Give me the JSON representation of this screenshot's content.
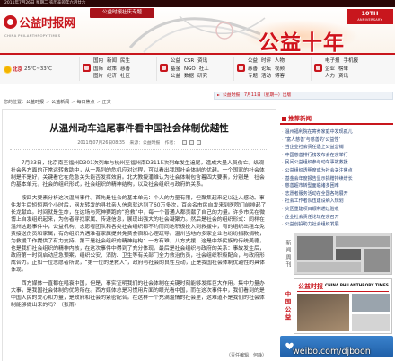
{
  "topbar": {
    "date": "2011年7月26日 星期二 农历辛卯年六月廿六"
  },
  "header": {
    "logo_cn": "公益时报网",
    "logo_en": "CHINA PHILANTHROPY TIMES",
    "special_tag": "公益时报社庆专题",
    "banner_title": "公益十年",
    "anniversary_num": "10TH",
    "anniversary_word": "ANNIVERSARY"
  },
  "weather": {
    "city": "北京",
    "temp": "25℃~33℃",
    "icon": "sun-icon"
  },
  "nav": {
    "groups": [
      {
        "icon": "news-icon",
        "rows": [
          [
            "国内",
            "新闻",
            "民生"
          ],
          [
            "国际",
            "政策",
            "慈善"
          ],
          [
            "图片",
            "经济",
            "社区"
          ]
        ]
      },
      {
        "icon": "charity-icon",
        "rows": [
          [
            "公益",
            "CSR",
            "资讯"
          ],
          [
            "基金",
            "NGO",
            "社工"
          ],
          [
            "公益",
            "数据",
            "研究"
          ]
        ]
      },
      {
        "icon": "comment-icon",
        "rows": [
          [
            "公益",
            "时评",
            "人物"
          ],
          [
            "慈善",
            "论坛",
            "视频"
          ],
          [
            "专题",
            "活动",
            "博客"
          ]
        ]
      },
      {
        "icon": "mobile-icon",
        "rows": [
          [
            "电子报",
            "手机报"
          ],
          [
            "企业",
            "榜单"
          ],
          [
            "人力",
            "资讯"
          ]
        ]
      }
    ]
  },
  "notice": "公益时报：7月11日（星期一）出版",
  "breadcrumb": {
    "label": "您的位置：",
    "sep": ">",
    "items": [
      "公益时报",
      "公益新闻",
      "每日焦点",
      "正文"
    ]
  },
  "article": {
    "title": "从温州动车追尾事件看中国社会体制优越性",
    "date": "2011年07月26日08:35",
    "source": "来源：公益时报",
    "author": "作者：",
    "paragraphs": [
      "7月23日，北京南至福州D301次列车与杭州至福州南D3115次列车发生追尾，造成大量人员伤亡。纵观社会各方面的正常运转救助中，从一系列的危机应对过程，可以看出我国社会体制的优越。一个国家的社会体制是不是好，关键看它在危急关头能否发挥效用。北大教授潘维认为社会体制包含着四大要素，分别是：社会的基本单元，社会的组织形式，社会组织的精神结构，以及社会组织与政府的关系。",
      "按四大要素分析这次温州事件。首先是社会的基本单元：个人的力量有限，但聚集起来足以让人感动。事件发生后短短两个小时后，网友转发的寻找亲人信息就达到了60万多次，百余名市民自发来到医院门前排起了长龙献血。时间就是生命，在这场与死神赛跑的“抢救”中，每一个普通人都贡献了自己的力量。许多市民在微博上自发组织起来，为伤者寻找家属、传递信息，展现出强大的社会凝聚力。然后是社会的组织形式：同样在温州这起事件中，公益机构、志愿者团队和各类社会组织都不约而同地积极投入到救援中，有的组织出租车免费接送伤员和家属，有的组织为遇难者家属提供免费食宿和心理疏导。温州当地的多家企业也纷纷捐款捐物，为救援工作提供了有力支持。第三是社会组织的精神结构：一方有难，八方支援，这是中华民族的传统美德，也是我们社会组织的精神内核，在这次事件中得到了充分体现。最后是社会组织与政府的关系：事故发生后，政府第一时间启动应急预案，组织公安、消防、卫生等有关部门全力救治伤员，社会组织积极配合，与政府形成合力。正如一位志愿者所说，“第一位的是救人”，政府与社会的良性互动，正是我国社会体制优越性的具体体现。",
      "西方媒体一直都在唱衰中国，但是，事实证明我们的社会体制在关键时刻能够发挥巨大作用。集中力量办大事，是我国社会体制的优势所在。西方媒体总是习惯用片面的眼光看中国，而在这次事件中，我们看到的是中国人民的爱心和力量，是政府和社会的紧密配合。在这样一个充满温情的社会里，这难道不是我们的社会体制能够做出来的吗？（张雨）"
    ],
    "editor": "（责任编辑：何静）"
  },
  "sidebar": {
    "recommend_title": "推荐新闻",
    "items": [
      "温州福利院在寄养家庭中发现孤儿",
      "‘富人慈善’与慈善的‘公益性’",
      "当企业社会责任遇上公益营销",
      "中国慈善排行榜发布会在京举行",
      "民间公益组织参与动车事故救援",
      "公益组织透明度成为社会关注焦点",
      "基金会年度报告显示捐赠持续增长",
      "慈善超市转型面临诸多困难",
      "志愿者服务活动在全国各地展开",
      "社会工作者队伍建设纳入规划",
      "灾区重建项目顺利通过验收",
      "企业社会责任论坛在京召开",
      "公益创投助力社会组织发展"
    ],
    "weekly_label": "新闻周刊",
    "paper_label": "中国公益",
    "paper_masthead_cn": "公益时报",
    "paper_masthead_en": "CHINA PHILANTHROPY TIMES"
  },
  "watermark": "weibo.com/djboon",
  "colors": {
    "brand_red": "#c8161d",
    "topbar": "#2a0707",
    "link_blue": "#243f73",
    "banner_blue": "#2f74bf"
  }
}
